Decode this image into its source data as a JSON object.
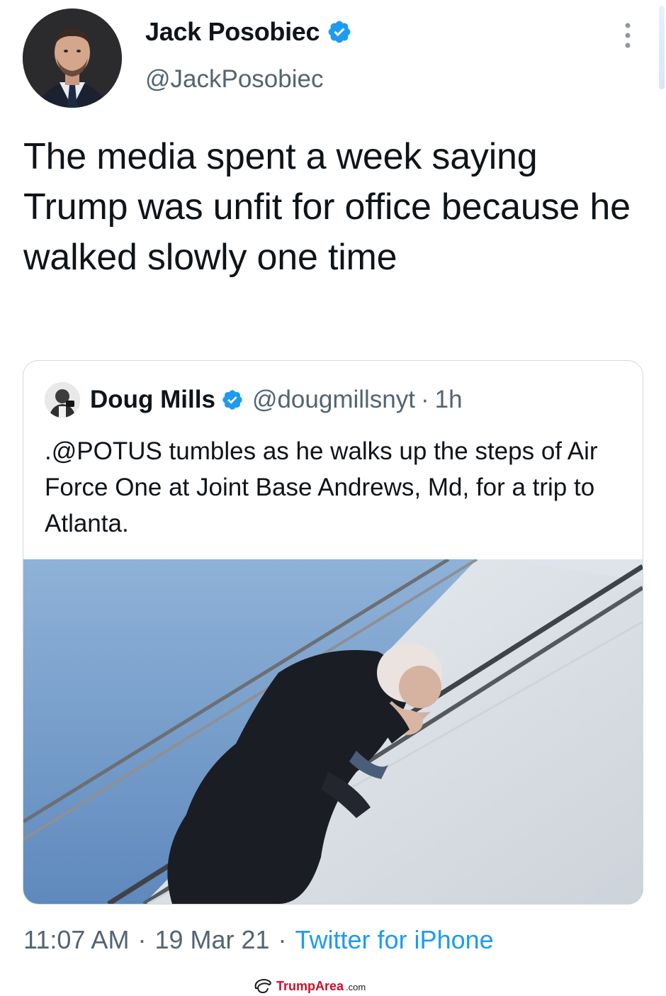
{
  "tweet": {
    "author": {
      "name": "Jack Posobiec",
      "handle": "@JackPosobiec",
      "verified": true
    },
    "text": "The media spent a week saying Trump was unfit for office because he walked slowly one time",
    "timestamp": "11:07 AM",
    "date": "19 Mar 21",
    "source": "Twitter for iPhone",
    "separator": "·"
  },
  "quoted_tweet": {
    "author": {
      "name": "Doug Mills",
      "handle": "@dougmillsnyt",
      "verified": true
    },
    "age": "1h",
    "text": ".@POTUS tumbles as he walks up the steps of Air Force One at Joint Base Andrews, Md, for a trip to Atlanta."
  },
  "watermark": {
    "brand": "TrumpArea",
    "tld": ".com"
  },
  "icons": {
    "verified": "verified-badge-icon",
    "more": "more-options-icon",
    "watermark": "trump-hair-logo-icon"
  },
  "colors": {
    "accent": "#1d9bf0",
    "text": "#0f1419",
    "muted": "#536471",
    "border": "#cfd9de",
    "watermark_red": "#c8102e"
  }
}
